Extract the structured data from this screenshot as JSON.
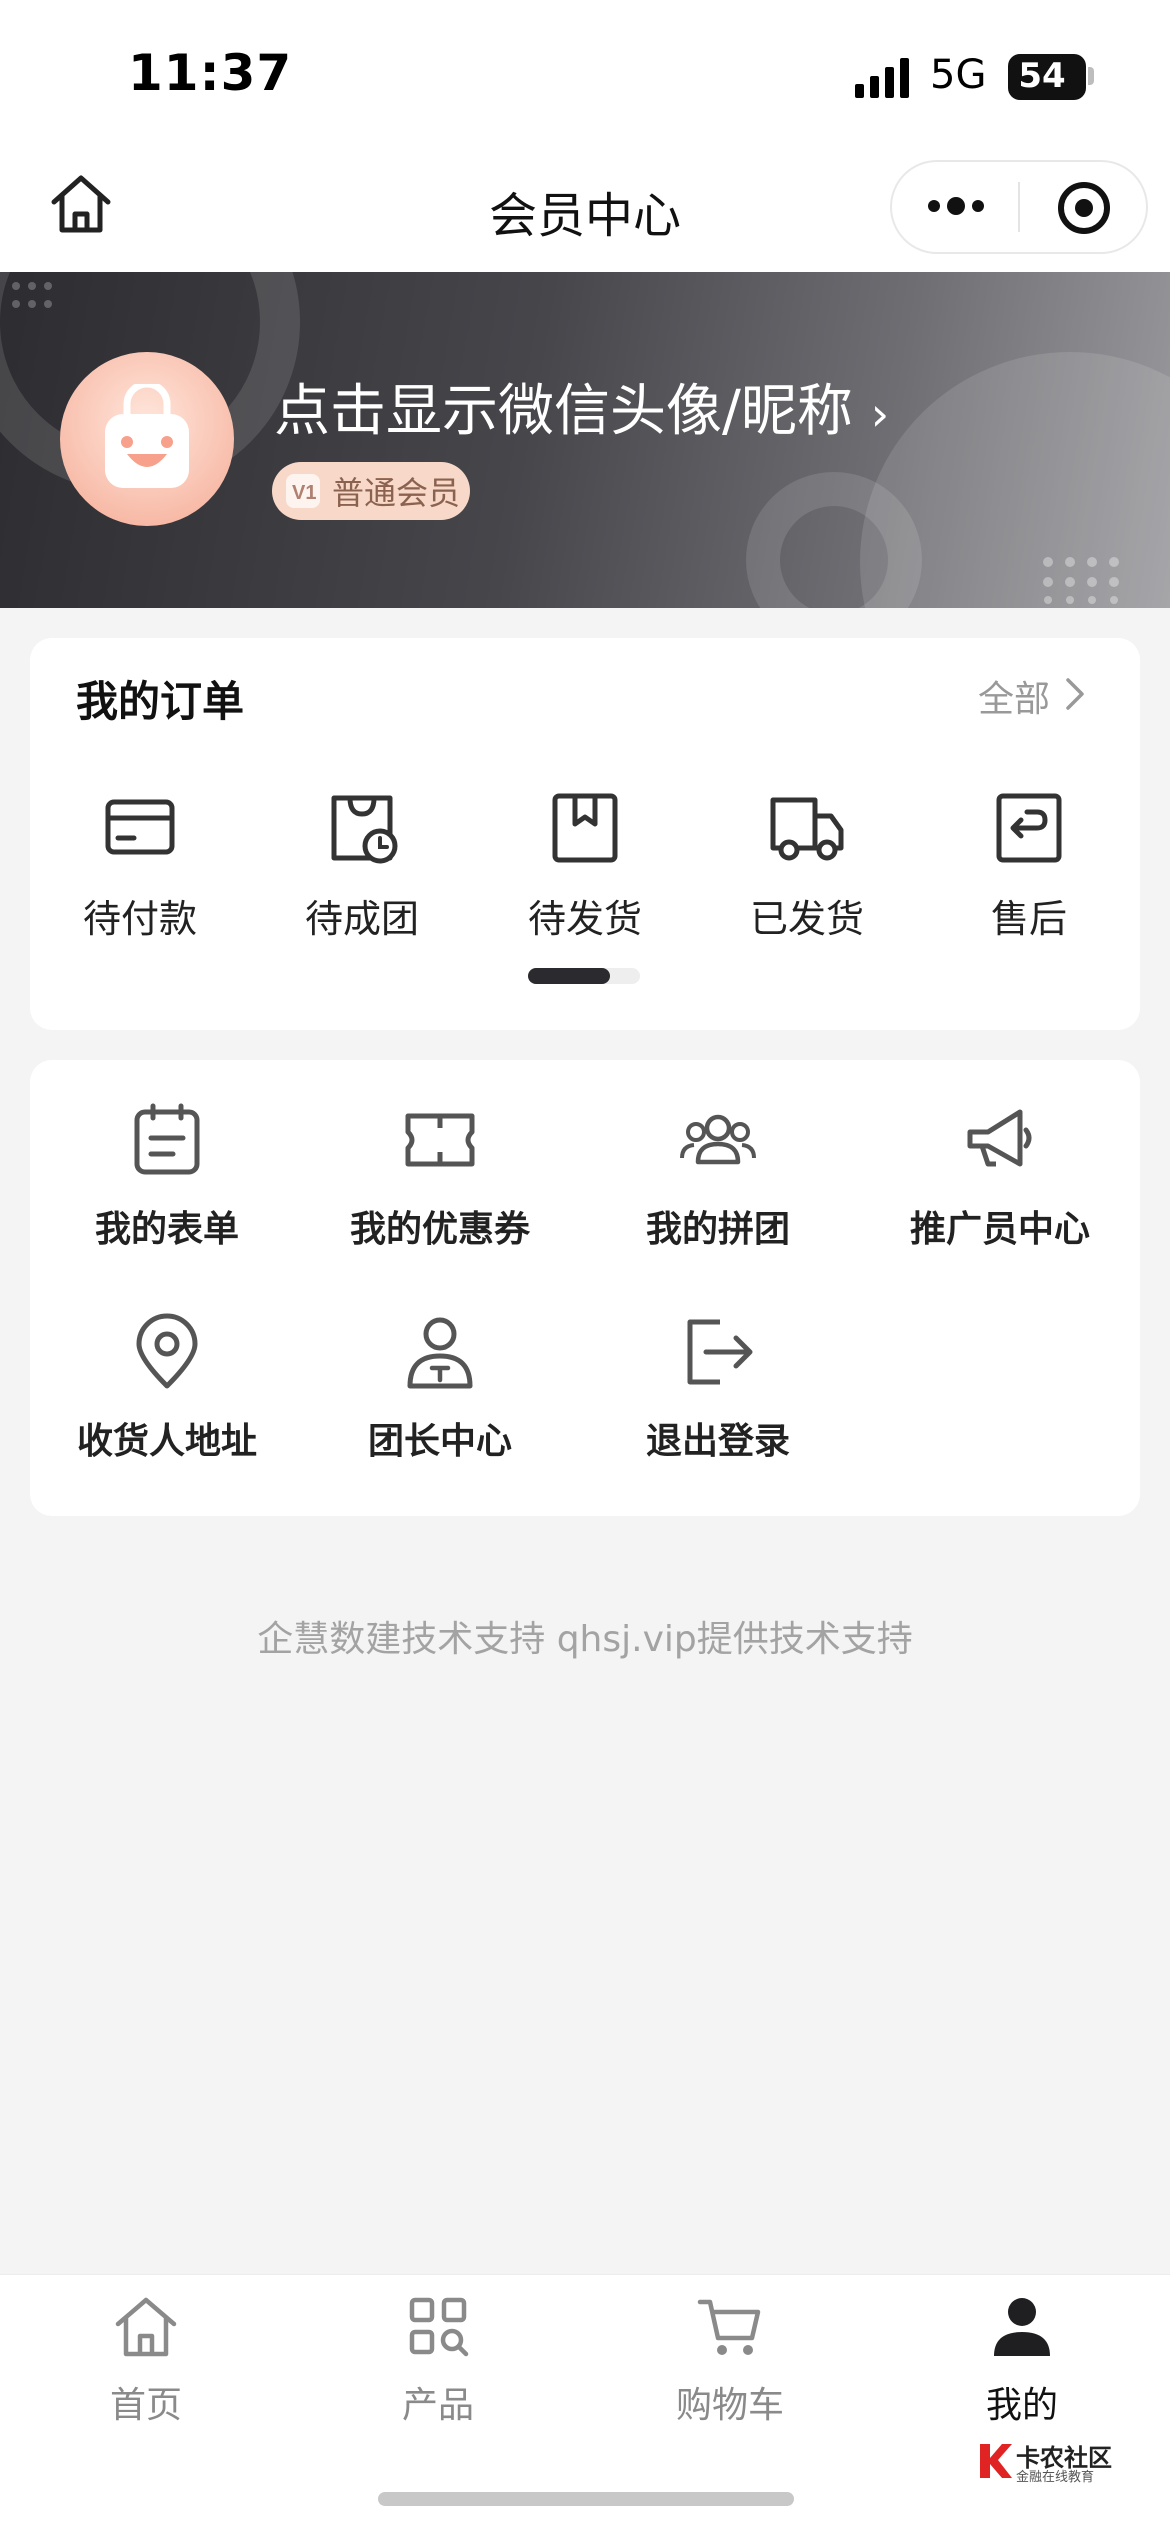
{
  "status_bar": {
    "time": "11:37",
    "network": "5G",
    "battery": "54"
  },
  "nav": {
    "title": "会员中心"
  },
  "profile": {
    "nickname": "点击显示微信头像/昵称",
    "chevron": "›",
    "member_level": "普通会员"
  },
  "orders": {
    "title": "我的订单",
    "all_label": "全部",
    "items": [
      {
        "label": "待付款",
        "icon": "card-icon"
      },
      {
        "label": "待成团",
        "icon": "bag-clock-icon"
      },
      {
        "label": "待发货",
        "icon": "box-icon"
      },
      {
        "label": "已发货",
        "icon": "truck-icon"
      },
      {
        "label": "售后",
        "icon": "return-icon"
      }
    ]
  },
  "tools": [
    {
      "label": "我的表单",
      "icon": "form-icon"
    },
    {
      "label": "我的优惠券",
      "icon": "coupon-icon"
    },
    {
      "label": "我的拼团",
      "icon": "group-icon"
    },
    {
      "label": "推广员中心",
      "icon": "megaphone-icon"
    },
    {
      "label": "收货人地址",
      "icon": "location-icon"
    },
    {
      "label": "团长中心",
      "icon": "leader-icon"
    },
    {
      "label": "退出登录",
      "icon": "logout-icon"
    }
  ],
  "footer": {
    "tech_support": "企慧数建技术支持 qhsj.vip提供技术支持"
  },
  "tabbar": [
    {
      "label": "首页",
      "icon": "home-icon",
      "active": false
    },
    {
      "label": "产品",
      "icon": "grid-search-icon",
      "active": false
    },
    {
      "label": "购物车",
      "icon": "cart-icon",
      "active": false
    },
    {
      "label": "我的",
      "icon": "user-icon",
      "active": true
    }
  ],
  "watermark": {
    "name": "卡农社区",
    "slogan": "金融在线教育"
  },
  "colors": {
    "banner_dark": "#2d2d31",
    "badge_bg": "#f8d9c9",
    "active_tab": "#111111",
    "inactive_tab": "#8a8a8a"
  }
}
